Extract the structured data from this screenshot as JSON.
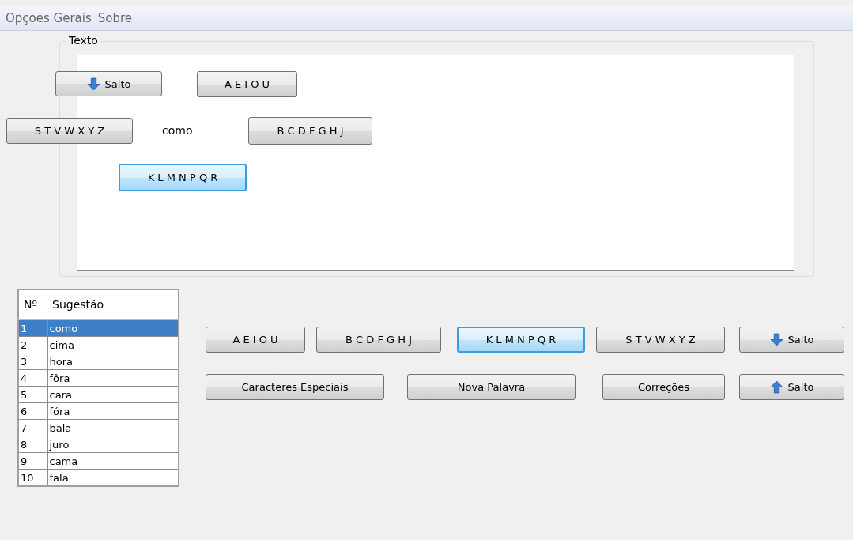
{
  "menu": [
    "Opções Gerais",
    "Sobre"
  ],
  "group": {
    "title": "Texto"
  },
  "canvas_items": [
    {
      "kind": "jump_down",
      "label": "Salto",
      "focused": false
    },
    {
      "kind": "key",
      "label": "A E I O U",
      "focused": false
    },
    {
      "kind": "key",
      "label": "S T V W X Y Z",
      "focused": false
    },
    {
      "kind": "word",
      "label": "como"
    },
    {
      "kind": "key",
      "label": "B C D F G H J",
      "focused": false
    },
    {
      "kind": "key",
      "label": "K L M N P Q R",
      "focused": true
    }
  ],
  "table": {
    "columns": [
      "Nº",
      "Sugestão"
    ],
    "rows": [
      {
        "cells": [
          "1",
          "como"
        ],
        "selected": true
      },
      {
        "cells": [
          "2",
          "cima"
        ],
        "selected": false
      },
      {
        "cells": [
          "3",
          "hora"
        ],
        "selected": false
      },
      {
        "cells": [
          "4",
          "fôra"
        ],
        "selected": false
      },
      {
        "cells": [
          "5",
          "cara"
        ],
        "selected": false
      },
      {
        "cells": [
          "6",
          "fóra"
        ],
        "selected": false
      },
      {
        "cells": [
          "7",
          "bala"
        ],
        "selected": false
      },
      {
        "cells": [
          "8",
          "juro"
        ],
        "selected": false
      },
      {
        "cells": [
          "9",
          "cama"
        ],
        "selected": false
      },
      {
        "cells": [
          "10",
          "fala"
        ],
        "selected": false
      }
    ]
  },
  "button_rows": [
    [
      {
        "kind": "key",
        "label": "A E I O U",
        "focused": false
      },
      {
        "kind": "key",
        "label": "B C D F G H J",
        "focused": false
      },
      {
        "kind": "key",
        "label": "K L M N P Q R",
        "focused": true
      },
      {
        "kind": "key",
        "label": "S T V W X Y Z",
        "focused": false
      },
      {
        "kind": "jump_down",
        "label": "Salto",
        "focused": false
      }
    ],
    [
      {
        "kind": "action",
        "label": "Caracteres Especiais",
        "focused": false
      },
      {
        "kind": "action",
        "label": "Nova Palavra",
        "focused": false
      },
      {
        "kind": "action",
        "label": "Correções",
        "focused": false
      },
      {
        "kind": "jump_up",
        "label": "Salto",
        "focused": false
      }
    ]
  ]
}
